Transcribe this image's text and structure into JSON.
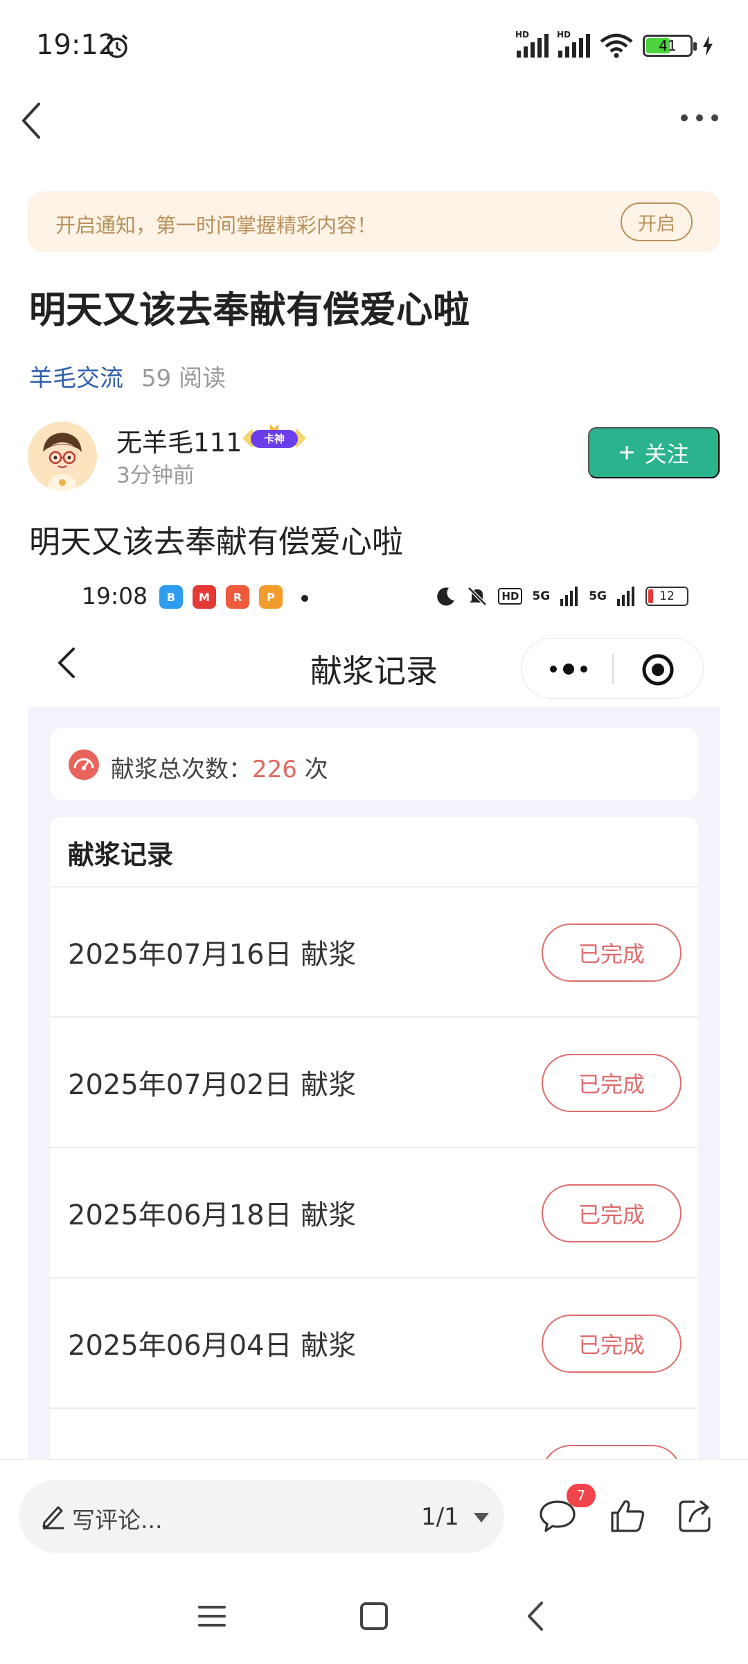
{
  "status_bar": {
    "time": "19:12",
    "battery": "41",
    "signal_label": "HD"
  },
  "nav": {
    "back": "back",
    "more": "more"
  },
  "notice": {
    "text": "开启通知，第一时间掌握精彩内容！",
    "button": "开启"
  },
  "post": {
    "title": "明天又该去奉献有偿爱心啦",
    "category": "羊毛交流",
    "reads": "59 阅读",
    "body": "明天又该去奉献有偿爱心啦"
  },
  "author": {
    "name": "无羊毛111",
    "badge": "卡神",
    "time": "3分钟前",
    "follow_label": "关注"
  },
  "screenshot": {
    "status": {
      "time": "19:08",
      "battery": "12",
      "network": "5G",
      "hd": "HD",
      "app_icons": [
        "B",
        "M",
        "R",
        "P"
      ]
    },
    "page_title": "献浆记录",
    "total_label": "献浆总次数：",
    "total_count": "226",
    "total_unit": " 次",
    "records_heading": "献浆记录",
    "records": [
      {
        "date": "2025年07月16日 献浆",
        "status": "已完成"
      },
      {
        "date": "2025年07月02日 献浆",
        "status": "已完成"
      },
      {
        "date": "2025年06月18日 献浆",
        "status": "已完成"
      },
      {
        "date": "2025年06月04日 献浆",
        "status": "已完成"
      }
    ]
  },
  "bottom_bar": {
    "comment_placeholder": "写评论...",
    "page": "1/1",
    "comment_count": "7"
  },
  "colors": {
    "accent_green": "#2bb38e",
    "notice_gold": "#b9905b",
    "category_blue": "#2f5fad",
    "status_red": "#df6c6c"
  }
}
